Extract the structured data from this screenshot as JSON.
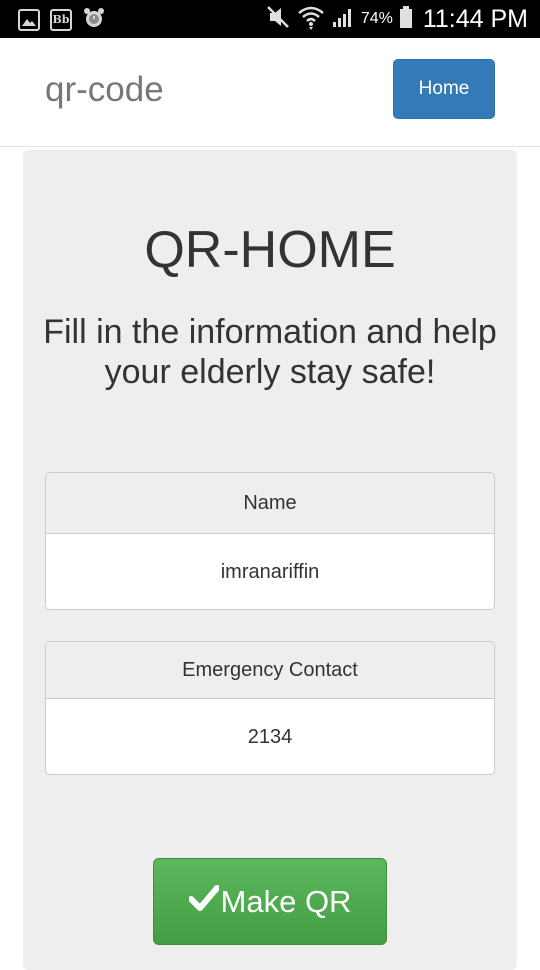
{
  "status_bar": {
    "left_icons": [
      "gallery-icon",
      "blackboard-icon",
      "alarm-icon"
    ],
    "bb_label": "Bb",
    "right_icons": [
      "mute-icon",
      "wifi-icon",
      "signal-icon",
      "battery-icon"
    ],
    "battery_percent": "74%",
    "time": "11:44 PM"
  },
  "navbar": {
    "brand": "qr-code",
    "home_label": "Home"
  },
  "main": {
    "title": "QR-HOME",
    "subtitle": "Fill in the information and help your elderly stay safe!",
    "fields": [
      {
        "label": "Name",
        "value": "imranariffin"
      },
      {
        "label": "Emergency Contact",
        "value": "2134"
      }
    ],
    "make_qr_label": "Make QR",
    "make_qr_icon": "checkmark-icon"
  },
  "colors": {
    "primary": "#337ab7",
    "success": "#5cb85c",
    "jumbotron": "#eeeeee"
  }
}
